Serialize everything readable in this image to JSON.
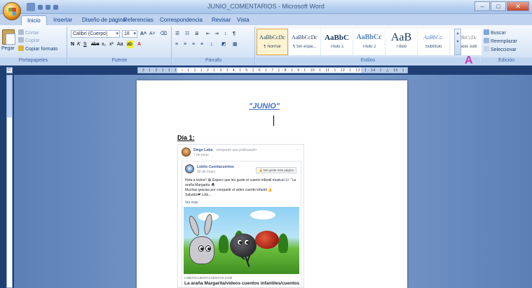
{
  "window": {
    "title": "JUNIO_COMENTARIOS - Microsoft Word",
    "controls": {
      "minimize": "–",
      "maximize": "□",
      "close": "✕"
    }
  },
  "tabs": [
    "Inicio",
    "Insertar",
    "Diseño de página",
    "Referencias",
    "Correspondencia",
    "Revisar",
    "Vista"
  ],
  "ribbon": {
    "clipboard": {
      "paste": "Pegar",
      "cut": "Cortar",
      "copy": "Copiar",
      "format_painter": "Copiar formato",
      "label": "Portapapeles"
    },
    "font": {
      "font_name": "Calibri (Cuerpo)",
      "font_size": "18",
      "label": "Fuente"
    },
    "paragraph": {
      "label": "Párrafo"
    },
    "styles": {
      "items": [
        {
          "sample": "AaBbCcDc",
          "name": "¶ Normal"
        },
        {
          "sample": "AaBbCcDc",
          "name": "¶ Sin espa..."
        },
        {
          "sample": "AaBbC",
          "name": "Título 1"
        },
        {
          "sample": "AaBbCc",
          "name": "Título 2"
        },
        {
          "sample": "AaB",
          "name": "Título"
        },
        {
          "sample": "AaBbCc.",
          "name": "Subtítulo"
        },
        {
          "sample": "AaBbCcDc",
          "name": "Énfasis sutil"
        }
      ],
      "change_styles": "Cambiar estilos",
      "label": "Estilos"
    },
    "editing": {
      "find": "Buscar",
      "replace": "Reemplazar",
      "select": "Seleccionar",
      "label": "Edición"
    }
  },
  "document": {
    "title": "\"JUNIO\"",
    "day_label": "Día 1:",
    "post": {
      "author": "Diego Lobo",
      "action": "compartió una publicación",
      "date": "7 de junio",
      "page_name": "Lobito Cuentacuentos",
      "page_date": "30 de mayo",
      "like_page": "Me gusta esta página",
      "text_line1": "Hola a todos!! 😀 Espero que les guste el cuento infantil musical 🎶 \"La",
      "text_line2": "araña Margarita 🕷",
      "text_line3": "Muchas gracias por compartir el video cuento infantil 👍",
      "text_line4": "Saludos❤ Lobi...",
      "see_more": "Ver más",
      "link_domain": "LOBITOCUENTACUENTOS.COM",
      "link_title": "La araña Margarita/videos cuentos infantiles/cuentos con"
    }
  }
}
